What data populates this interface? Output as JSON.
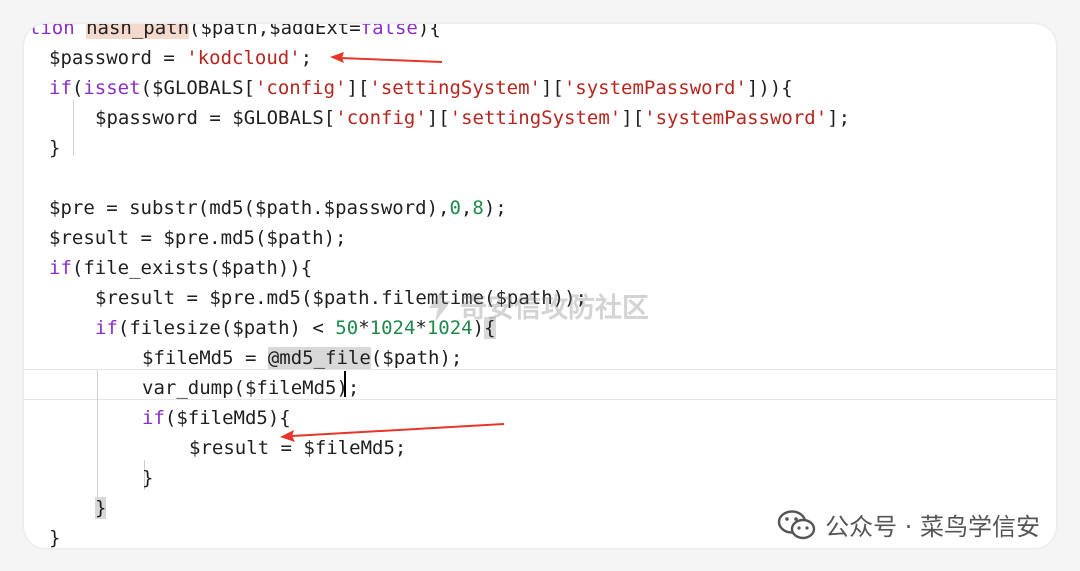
{
  "code_lines": [
    [
      {
        "c": "kw",
        "t": "nction "
      },
      {
        "c": "fn hl",
        "t": "hash_path"
      },
      {
        "c": "pun",
        "t": "("
      },
      {
        "c": "var",
        "t": "$path"
      },
      {
        "c": "pun",
        "t": ","
      },
      {
        "c": "var",
        "t": "$addExt"
      },
      {
        "c": "op",
        "t": "="
      },
      {
        "c": "kw",
        "t": "false"
      },
      {
        "c": "pun",
        "t": "){"
      }
    ],
    [
      {
        "c": "var",
        "t": "$password"
      },
      {
        "c": "op",
        "t": " = "
      },
      {
        "c": "str",
        "t": "'kodcloud'"
      },
      {
        "c": "pun",
        "t": ";"
      }
    ],
    [
      {
        "c": "kw",
        "t": "if"
      },
      {
        "c": "pun",
        "t": "("
      },
      {
        "c": "kw",
        "t": "isset"
      },
      {
        "c": "pun",
        "t": "("
      },
      {
        "c": "var",
        "t": "$GLOBALS"
      },
      {
        "c": "pun",
        "t": "["
      },
      {
        "c": "str",
        "t": "'config'"
      },
      {
        "c": "pun",
        "t": "]["
      },
      {
        "c": "str",
        "t": "'settingSystem'"
      },
      {
        "c": "pun",
        "t": "]["
      },
      {
        "c": "str",
        "t": "'systemPassword'"
      },
      {
        "c": "pun",
        "t": "])){"
      }
    ],
    [
      {
        "c": "var",
        "t": "$password"
      },
      {
        "c": "op",
        "t": " = "
      },
      {
        "c": "var",
        "t": "$GLOBALS"
      },
      {
        "c": "pun",
        "t": "["
      },
      {
        "c": "str",
        "t": "'config'"
      },
      {
        "c": "pun",
        "t": "]["
      },
      {
        "c": "str",
        "t": "'settingSystem'"
      },
      {
        "c": "pun",
        "t": "]["
      },
      {
        "c": "str",
        "t": "'systemPassword'"
      },
      {
        "c": "pun",
        "t": "];"
      }
    ],
    [
      {
        "c": "pun",
        "t": "}"
      }
    ],
    [],
    [
      {
        "c": "var",
        "t": "$pre"
      },
      {
        "c": "op",
        "t": " = "
      },
      {
        "c": "fn",
        "t": "substr"
      },
      {
        "c": "pun",
        "t": "("
      },
      {
        "c": "fn",
        "t": "md5"
      },
      {
        "c": "pun",
        "t": "("
      },
      {
        "c": "var",
        "t": "$path"
      },
      {
        "c": "op",
        "t": "."
      },
      {
        "c": "var",
        "t": "$password"
      },
      {
        "c": "pun",
        "t": "),"
      },
      {
        "c": "num",
        "t": "0"
      },
      {
        "c": "pun",
        "t": ","
      },
      {
        "c": "num",
        "t": "8"
      },
      {
        "c": "pun",
        "t": ");"
      }
    ],
    [
      {
        "c": "var",
        "t": "$result"
      },
      {
        "c": "op",
        "t": " = "
      },
      {
        "c": "var",
        "t": "$pre"
      },
      {
        "c": "op",
        "t": "."
      },
      {
        "c": "fn",
        "t": "md5"
      },
      {
        "c": "pun",
        "t": "("
      },
      {
        "c": "var",
        "t": "$path"
      },
      {
        "c": "pun",
        "t": ");"
      }
    ],
    [
      {
        "c": "kw",
        "t": "if"
      },
      {
        "c": "pun",
        "t": "("
      },
      {
        "c": "fn",
        "t": "file_exists"
      },
      {
        "c": "pun",
        "t": "("
      },
      {
        "c": "var",
        "t": "$path"
      },
      {
        "c": "pun",
        "t": ")){"
      }
    ],
    [
      {
        "c": "var",
        "t": "$result"
      },
      {
        "c": "op",
        "t": " = "
      },
      {
        "c": "var",
        "t": "$pre"
      },
      {
        "c": "op",
        "t": "."
      },
      {
        "c": "fn",
        "t": "md5"
      },
      {
        "c": "pun",
        "t": "("
      },
      {
        "c": "var",
        "t": "$path"
      },
      {
        "c": "op",
        "t": "."
      },
      {
        "c": "fn",
        "t": "filemtime"
      },
      {
        "c": "pun",
        "t": "("
      },
      {
        "c": "var",
        "t": "$path"
      },
      {
        "c": "pun",
        "t": "));"
      }
    ],
    [
      {
        "c": "kw",
        "t": "if"
      },
      {
        "c": "pun",
        "t": "("
      },
      {
        "c": "fn",
        "t": "filesize"
      },
      {
        "c": "pun",
        "t": "("
      },
      {
        "c": "var",
        "t": "$path"
      },
      {
        "c": "pun",
        "t": ") "
      },
      {
        "c": "op",
        "t": "< "
      },
      {
        "c": "num",
        "t": "50"
      },
      {
        "c": "op",
        "t": "*"
      },
      {
        "c": "num",
        "t": "1024"
      },
      {
        "c": "op",
        "t": "*"
      },
      {
        "c": "num",
        "t": "1024"
      },
      {
        "c": "pun",
        "t": ")"
      },
      {
        "c": "pun hlmatch",
        "t": "{"
      }
    ],
    [
      {
        "c": "var",
        "t": "$fileMd5"
      },
      {
        "c": "op",
        "t": " = "
      },
      {
        "c": "op hlmatch",
        "t": "@md5_file"
      },
      {
        "c": "pun",
        "t": "("
      },
      {
        "c": "var",
        "t": "$path"
      },
      {
        "c": "pun",
        "t": ");"
      }
    ],
    [
      {
        "c": "fn",
        "t": "var_dump"
      },
      {
        "c": "pun",
        "t": "("
      },
      {
        "c": "var",
        "t": "$fileMd5"
      },
      {
        "c": "pun",
        "t": ");"
      }
    ],
    [
      {
        "c": "kw",
        "t": "if"
      },
      {
        "c": "pun",
        "t": "("
      },
      {
        "c": "var",
        "t": "$fileMd5"
      },
      {
        "c": "pun",
        "t": "){"
      }
    ],
    [
      {
        "c": "var",
        "t": "$result"
      },
      {
        "c": "op",
        "t": " = "
      },
      {
        "c": "var",
        "t": "$fileMd5"
      },
      {
        "c": "pun",
        "t": ";"
      }
    ],
    [
      {
        "c": "pun",
        "t": "}"
      }
    ],
    [
      {
        "c": "pun hlmatch",
        "t": "}"
      }
    ],
    [
      {
        "c": "pun",
        "t": "}"
      }
    ]
  ],
  "watermark": {
    "text": "奇安信攻防社区"
  },
  "wechat": {
    "text": "公众号 · 菜鸟学信安"
  },
  "colors": {
    "keyword": "#8b2fc9",
    "string": "#b5261e",
    "number": "#1f8a4c",
    "arrow": "#e8352a"
  }
}
